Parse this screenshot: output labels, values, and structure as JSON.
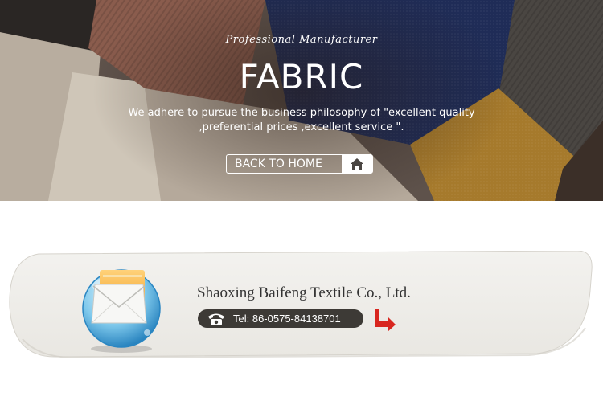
{
  "hero": {
    "tagline": "Professional Manufacturer",
    "title": "FABRIC",
    "description_line1": "We adhere to pursue the business philosophy of \"excellent quality",
    "description_line2": ",preferential prices ,excellent service \".",
    "back_button_label": "BACK TO HOME",
    "icons": {
      "home": "home-icon"
    }
  },
  "contact": {
    "company": "Shaoxing Baifeng Textile Co., Ltd.",
    "tel": "Tel: 86-0575-84138701",
    "icons": {
      "mail": "mail-icon",
      "phone": "phone-icon",
      "arrow": "arrow-down-right-icon"
    }
  },
  "colors": {
    "navy_fabric": "#1f2c57",
    "brown_fabric": "#8a5c4d",
    "mustard_fabric": "#a67a2c",
    "pill_bg": "#3d3a36",
    "arrow_red": "#d8261f",
    "card_bg": "#f0efeb"
  }
}
